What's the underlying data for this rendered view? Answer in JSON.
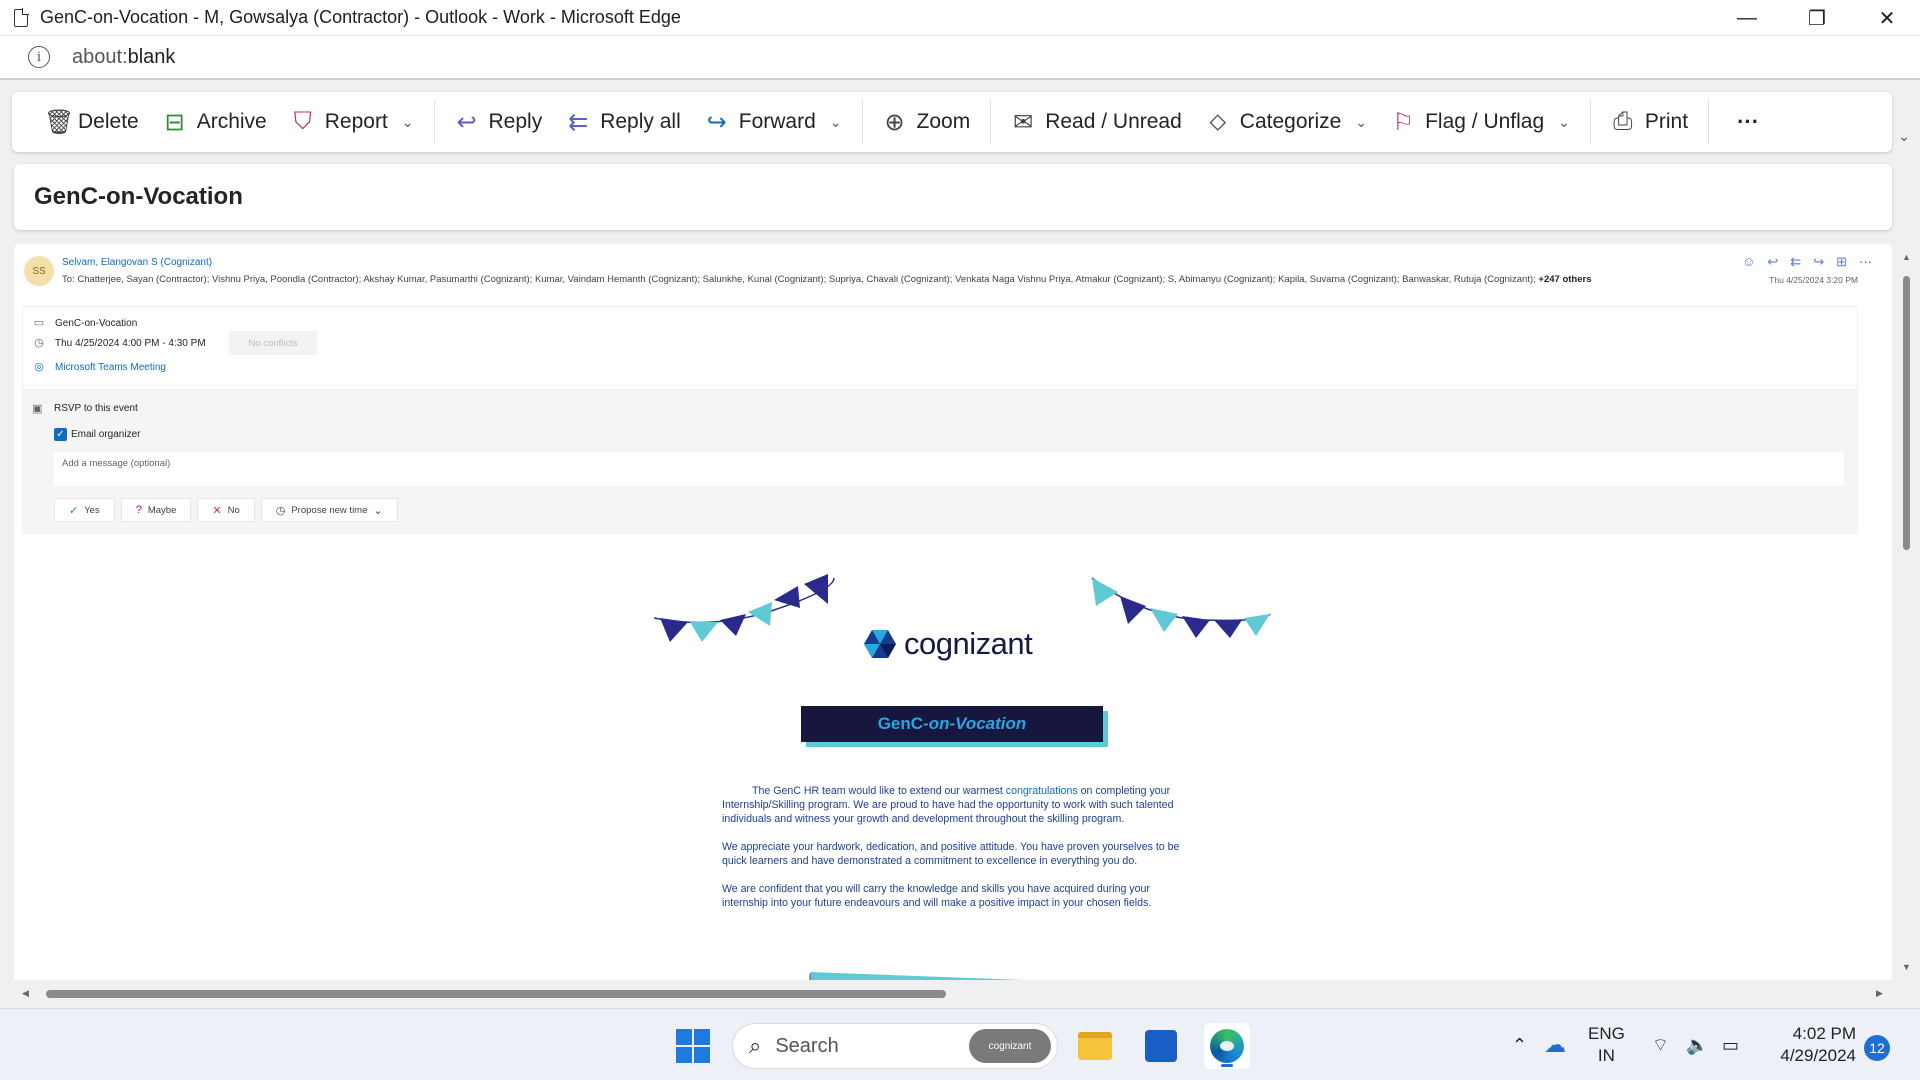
{
  "window": {
    "title": "GenC-on-Vocation - M, Gowsalya (Contractor) - Outlook - Work - Microsoft Edge",
    "minimize": "—",
    "restore": "❐",
    "close": "✕"
  },
  "address": {
    "scheme": "about:",
    "path": "blank"
  },
  "toolbar": {
    "delete": "Delete",
    "archive": "Archive",
    "report": "Report",
    "reply": "Reply",
    "reply_all": "Reply all",
    "forward": "Forward",
    "zoom": "Zoom",
    "read_unread": "Read / Unread",
    "categorize": "Categorize",
    "flag_unflag": "Flag / Unflag",
    "print": "Print",
    "more": "···"
  },
  "subject": "GenC-on-Vocation",
  "message": {
    "avatar_initials": "SS",
    "sender": "Selvam, Elangovan S (Cognizant)",
    "to_prefix": "To:",
    "recipients": "Chatterjee, Sayan (Contractor);   Vishnu Priya, Poondla (Contractor);   Akshay Kumar, Pasumarthi (Cognizant);   Kumar, Vaindam Hemanth (Cognizant);   Salunkhe, Kunal (Cognizant);   Supriya, Chavali (Cognizant);   Venkata Naga Vishnu Priya, Atmakur (Cognizant);   S, Abimanyu (Cognizant);   Kapila, Suvarna (Cognizant);   Banwaskar, Rutuja (Cognizant);",
    "others": "+247 others",
    "date": "Thu 4/25/2024 3:20 PM"
  },
  "event": {
    "title": "GenC-on-Vocation",
    "time": "Thu 4/25/2024 4:00 PM - 4:30 PM",
    "conflicts": "No conflicts",
    "location": "Microsoft Teams Meeting",
    "rsvp_title": "RSVP to this event",
    "email_organizer": "Email organizer",
    "message_placeholder": "Add a message (optional)",
    "yes": "Yes",
    "maybe": "Maybe",
    "no": "No",
    "propose": "Propose new time"
  },
  "email_body": {
    "logo_text": "cognizant",
    "banner_a": "GenC",
    "banner_b": "-on-Vocation",
    "p1_a": "The GenC HR team would like to extend our warmest",
    "p1_link": "congratulations",
    "p1_b": "on completing your Internship/Skilling program. We are proud to have had the opportunity to work with such talented individuals and witness your growth and development throughout the skilling program.",
    "p2": "We appreciate your hardwork, dedication, and positive attitude. You have proven yourselves to be quick learners and have demonstrated a commitment to excellence in everything you do.",
    "p3": "We are confident that you will carry the knowledge and skills you have acquired during your internship into your future endeavours and will make a positive impact in your chosen fields."
  },
  "taskbar": {
    "search": "Search",
    "search_chip": "cognizant",
    "lang_1": "ENG",
    "lang_2": "IN",
    "time": "4:02 PM",
    "date": "4/29/2024",
    "notifications": "12"
  },
  "colors": {
    "accent": "#0f6cbd",
    "banner_bg": "#16163f",
    "bunting_dark": "#2a2a8c",
    "bunting_teal": "#5fcad3"
  }
}
